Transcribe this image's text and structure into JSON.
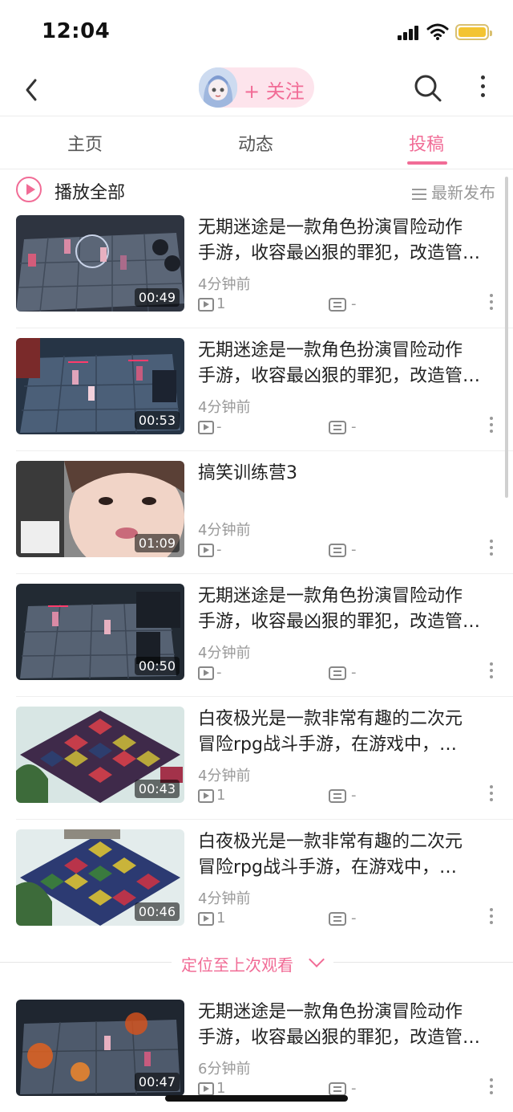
{
  "status_bar": {
    "time": "12:04"
  },
  "nav": {
    "follow_label": "+ 关注"
  },
  "tabs": [
    {
      "label": "主页",
      "active": false
    },
    {
      "label": "动态",
      "active": false
    },
    {
      "label": "投稿",
      "active": true
    }
  ],
  "toolbar": {
    "play_all": "播放全部",
    "sort": "最新发布"
  },
  "videos": [
    {
      "title_line1": "无期迷途是一款角色扮演冒险动作",
      "title_line2": "手游，收容最凶狠的罪犯，改造管…",
      "time": "4分钟前",
      "plays": "1",
      "comments": "-",
      "duration": "00:49"
    },
    {
      "title_line1": "无期迷途是一款角色扮演冒险动作",
      "title_line2": "手游，收容最凶狠的罪犯，改造管…",
      "time": "4分钟前",
      "plays": "-",
      "comments": "-",
      "duration": "00:53"
    },
    {
      "title_line1": "搞笑训练营3",
      "title_line2": "",
      "time": "4分钟前",
      "plays": "-",
      "comments": "-",
      "duration": "01:09"
    },
    {
      "title_line1": "无期迷途是一款角色扮演冒险动作",
      "title_line2": "手游，收容最凶狠的罪犯，改造管…",
      "time": "4分钟前",
      "plays": "-",
      "comments": "-",
      "duration": "00:50"
    },
    {
      "title_line1": "白夜极光是一款非常有趣的二次元",
      "title_line2": "冒险rpg战斗手游，在游戏中，…",
      "time": "4分钟前",
      "plays": "1",
      "comments": "-",
      "duration": "00:43"
    },
    {
      "title_line1": "白夜极光是一款非常有趣的二次元",
      "title_line2": "冒险rpg战斗手游，在游戏中，…",
      "time": "4分钟前",
      "plays": "1",
      "comments": "-",
      "duration": "00:46"
    }
  ],
  "locate_last": "定位至上次观看",
  "videos_after": [
    {
      "title_line1": "无期迷途是一款角色扮演冒险动作",
      "title_line2": "手游，收容最凶狠的罪犯，改造管…",
      "time": "6分钟前",
      "plays": "1",
      "comments": "-",
      "duration": "00:47"
    }
  ],
  "colors": {
    "accent": "#f16c96",
    "accent_bg": "#fde4ec"
  }
}
